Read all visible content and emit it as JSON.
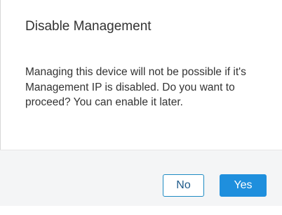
{
  "dialog": {
    "title": "Disable Management",
    "message": "Managing this device will not be possible if it's Management IP is disabled. Do you want to proceed? You can enable it later.",
    "buttons": {
      "no_label": "No",
      "yes_label": "Yes"
    }
  },
  "colors": {
    "primary_button": "#1f8fdd",
    "secondary_border": "#1e8bc3",
    "footer_background": "#f4f5f6",
    "text": "#333333"
  }
}
